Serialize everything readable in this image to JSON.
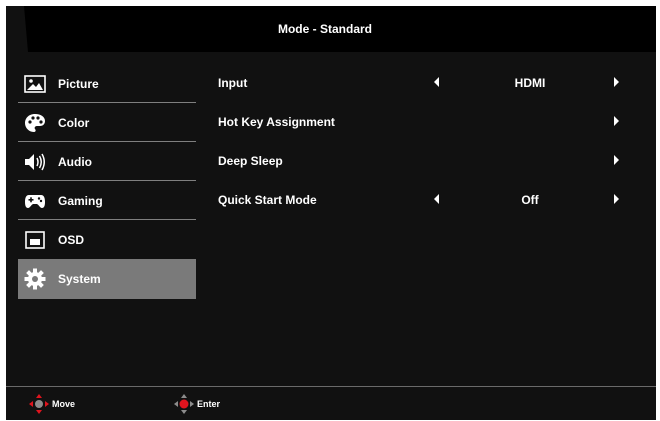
{
  "header": {
    "title": "Mode - Standard"
  },
  "sidebar": {
    "items": [
      {
        "label": "Picture",
        "icon": "picture-icon",
        "active": false
      },
      {
        "label": "Color",
        "icon": "palette-icon",
        "active": false
      },
      {
        "label": "Audio",
        "icon": "speaker-icon",
        "active": false
      },
      {
        "label": "Gaming",
        "icon": "gamepad-icon",
        "active": false
      },
      {
        "label": "OSD",
        "icon": "osd-icon",
        "active": false
      },
      {
        "label": "System",
        "icon": "gear-icon",
        "active": true
      }
    ]
  },
  "settings": {
    "rows": [
      {
        "label": "Input",
        "value": "HDMI",
        "has_left_arrow": true,
        "has_right_arrow": true
      },
      {
        "label": "Hot Key Assignment",
        "value": "",
        "has_left_arrow": false,
        "has_right_arrow": true
      },
      {
        "label": "Deep Sleep",
        "value": "",
        "has_left_arrow": false,
        "has_right_arrow": true
      },
      {
        "label": "Quick Start Mode",
        "value": "Off",
        "has_left_arrow": true,
        "has_right_arrow": true
      }
    ]
  },
  "footer": {
    "move_label": "Move",
    "enter_label": "Enter"
  },
  "colors": {
    "background": "#111111",
    "active_item": "#7a7a7a",
    "navpad_red": "#e0141e",
    "separator": "#7f7f7f"
  }
}
